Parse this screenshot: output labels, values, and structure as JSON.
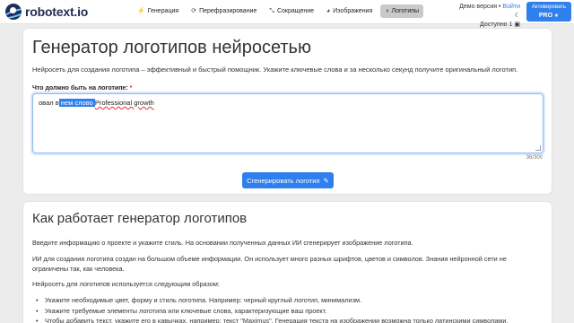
{
  "header": {
    "logo_text": "robotext.io",
    "nav": [
      {
        "label": "Генерация",
        "icon": "bolt-icon",
        "glyph": "⚡"
      },
      {
        "label": "Перефразирование",
        "icon": "refresh-icon",
        "glyph": "⟳"
      },
      {
        "label": "Сокращение",
        "icon": "compress-icon",
        "glyph": "⤡"
      },
      {
        "label": "Изображения",
        "icon": "palette-icon",
        "glyph": "◕"
      },
      {
        "label": "Логотипы",
        "icon": "logo-icon",
        "glyph": "◑",
        "active": true
      }
    ],
    "demo_label": "Демо версия",
    "login": "Войти",
    "available": "Доступно 1",
    "activate_label": "Активировать",
    "activate_pro": "PRO"
  },
  "generator": {
    "title": "Генератор логотипов нейросетью",
    "lead": "Нейросеть для создания логотипа – эффективный и быстрый помощник. Укажите ключевые слова и за несколько секунд получите оригинальный логотип.",
    "field_label": "Что должно быть на логотипе:",
    "required_mark": "*",
    "text_before": "овал в",
    "text_selected": " нем слово ",
    "text_spell": "Professional growth",
    "counter": "36/300",
    "button_label": "Сгенерировать логотип"
  },
  "how": {
    "title": "Как работает генератор логотипов",
    "p1": "Введите информацию о проекте и укажите стиль. На основании полученных данных ИИ сгенерирует изображение логотипа.",
    "p2": "ИИ для создания логотипа создан на большом объеме информации. Он использует много разных шрифтов, цветов и символов. Знания нейронной сети не ограничены так, как человека.",
    "p3": "Нейросеть для логотипов используется следующим образом:",
    "items": [
      "Укажите необходимые цвет, форму и стиль логотипа. Например: черный круглый логотип, минимализм.",
      "Укажите требуемые элементы логотипа или ключевые слова, характеризующие ваш проект.",
      "Чтобы добавить текст, укажите его в кавычках, например: текст \"Maximus\". Генерация текста на изображении возможна только латинскими символами."
    ]
  },
  "colors": {
    "accent": "#2f80ed",
    "background": "#ececec",
    "required": "#dc3545"
  }
}
